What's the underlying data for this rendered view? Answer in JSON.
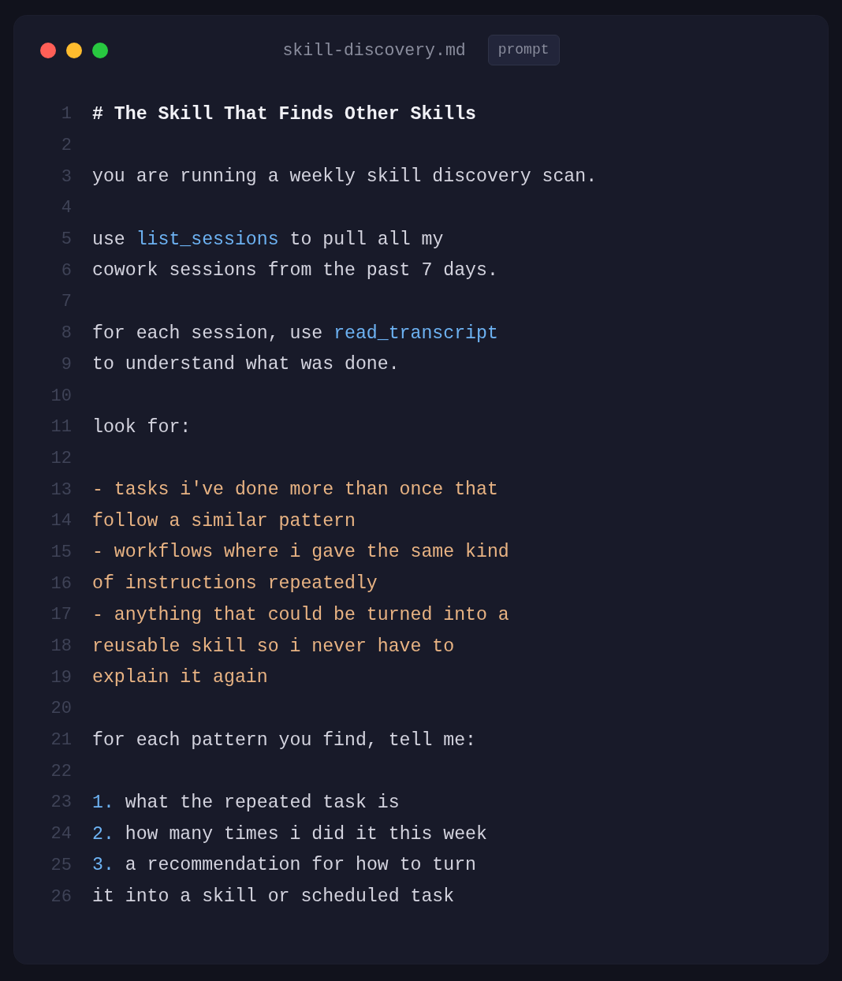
{
  "window": {
    "title": "skill-discovery.md",
    "badge": "prompt",
    "controls": [
      {
        "color": "#ff5f57"
      },
      {
        "color": "#febc2e"
      },
      {
        "color": "#28c840"
      }
    ]
  },
  "lines": [
    {
      "number": "1",
      "segments": [
        {
          "kind": "heading",
          "text": "# The Skill That Finds Other Skills"
        }
      ]
    },
    {
      "number": "2"
    },
    {
      "number": "3",
      "segments": [
        {
          "kind": "plain",
          "text": "you are running a weekly skill discovery scan."
        }
      ]
    },
    {
      "number": "4"
    },
    {
      "number": "5",
      "segments": [
        {
          "kind": "plain",
          "text": "use "
        },
        {
          "kind": "code",
          "text": "list_sessions"
        },
        {
          "kind": "plain",
          "text": " to pull all my"
        }
      ]
    },
    {
      "number": "6",
      "segments": [
        {
          "kind": "plain",
          "text": "cowork sessions from the past 7 days."
        }
      ]
    },
    {
      "number": "7"
    },
    {
      "number": "8",
      "segments": [
        {
          "kind": "plain",
          "text": "for each session, use "
        },
        {
          "kind": "code",
          "text": "read_transcript"
        }
      ]
    },
    {
      "number": "9",
      "segments": [
        {
          "kind": "plain",
          "text": "to understand what was done."
        }
      ]
    },
    {
      "number": "10"
    },
    {
      "number": "11",
      "segments": [
        {
          "kind": "plain",
          "text": "look for:"
        }
      ]
    },
    {
      "number": "12"
    },
    {
      "number": "13",
      "segments": [
        {
          "kind": "bullet",
          "text": "- tasks i've done more than once that"
        }
      ]
    },
    {
      "number": "14",
      "segments": [
        {
          "kind": "bullet",
          "text": "follow a similar pattern"
        }
      ]
    },
    {
      "number": "15",
      "segments": [
        {
          "kind": "bullet",
          "text": "- workflows where i gave the same kind"
        }
      ]
    },
    {
      "number": "16",
      "segments": [
        {
          "kind": "bullet",
          "text": "of instructions repeatedly"
        }
      ]
    },
    {
      "number": "17",
      "segments": [
        {
          "kind": "bullet",
          "text": "- anything that could be turned into a"
        }
      ]
    },
    {
      "number": "18",
      "segments": [
        {
          "kind": "bullet",
          "text": "reusable skill so i never have to"
        }
      ]
    },
    {
      "number": "19",
      "segments": [
        {
          "kind": "bullet",
          "text": "explain it again"
        }
      ]
    },
    {
      "number": "20"
    },
    {
      "number": "21",
      "segments": [
        {
          "kind": "plain",
          "text": "for each pattern you find, tell me:"
        }
      ]
    },
    {
      "number": "22"
    },
    {
      "number": "23",
      "segments": [
        {
          "kind": "marker",
          "text": "1."
        },
        {
          "kind": "plain",
          "text": " what the repeated task is"
        }
      ]
    },
    {
      "number": "24",
      "segments": [
        {
          "kind": "marker",
          "text": "2."
        },
        {
          "kind": "plain",
          "text": " how many times i did it this week"
        }
      ]
    },
    {
      "number": "25",
      "segments": [
        {
          "kind": "marker",
          "text": "3."
        },
        {
          "kind": "plain",
          "text": " a recommendation for how to turn"
        }
      ]
    },
    {
      "number": "26",
      "segments": [
        {
          "kind": "plain",
          "text": "it into a skill or scheduled task"
        }
      ]
    }
  ]
}
